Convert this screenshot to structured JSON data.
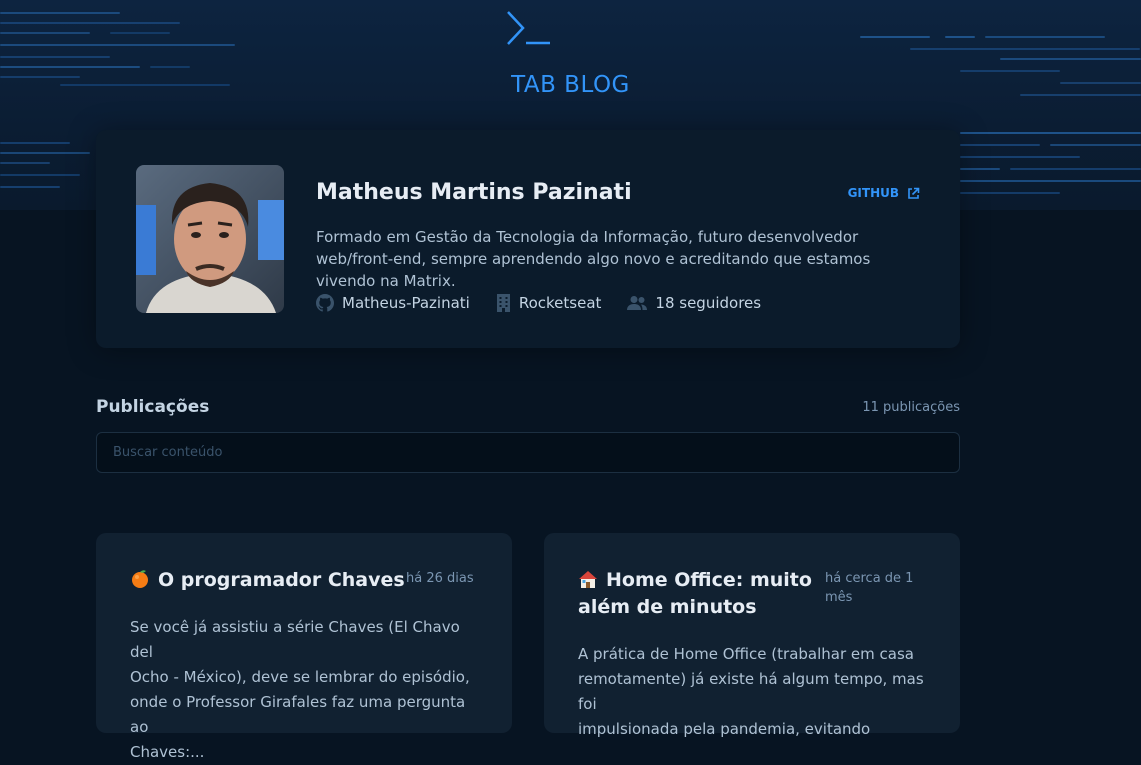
{
  "brand": {
    "name": "TAB BLOG",
    "logo_icon": "terminal-prompt-icon",
    "color": "#3294f8"
  },
  "profile": {
    "name": "Matheus Martins Pazinati",
    "github_link_label": "GITHUB",
    "bio": "Formado em Gestão da Tecnologia da Informação, futuro desenvolvedor web/front-end, sempre aprendendo algo novo e acreditando que estamos vivendo na Matrix.",
    "username": "Matheus-Pazinati",
    "company": "Rocketseat",
    "followers": "18 seguidores"
  },
  "publications": {
    "title": "Publicações",
    "count": "11 publicações",
    "search_placeholder": "Buscar conteúdo"
  },
  "posts": [
    {
      "title_lines": [
        "O programador Chaves"
      ],
      "emoji": "orange-icon",
      "date_lines": [
        "há 26 dias"
      ],
      "excerpt_lines": [
        "Se você já assistiu a série Chaves (El Chavo del",
        "Ocho - México), deve se lembrar do episódio,",
        "onde o Professor Girafales faz uma pergunta ao",
        "Chaves:..."
      ]
    },
    {
      "title_lines": [
        "Home Office: muito",
        "além de minutos"
      ],
      "emoji": "house-icon",
      "date_lines": [
        "há cerca de 1",
        "mês"
      ],
      "excerpt_lines": [
        "A prática de Home Office (trabalhar em casa",
        "remotamente) já existe há algum tempo, mas foi",
        "impulsionada pela pandemia, evitando"
      ]
    }
  ]
}
